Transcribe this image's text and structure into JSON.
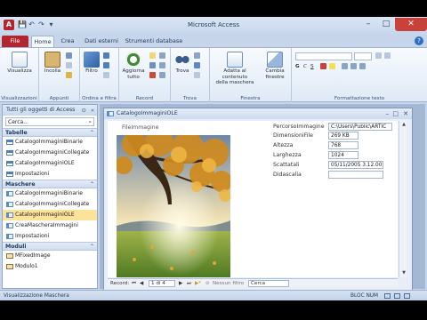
{
  "app": {
    "title": "Microsoft Access",
    "logo_letter": "A",
    "brand_color": "#b3262f"
  },
  "window_controls": {
    "minimize": "–",
    "maximize": "□",
    "close": "✕"
  },
  "quick_access": {
    "save": "💾",
    "undo": "↶",
    "redo": "↷",
    "customize": "▾"
  },
  "tabs": [
    {
      "label": "File"
    },
    {
      "label": "Home"
    },
    {
      "label": "Crea"
    },
    {
      "label": "Dati esterni"
    },
    {
      "label": "Strumenti database"
    }
  ],
  "ribbon": {
    "groups": {
      "views": {
        "label": "Visualizzazioni",
        "view_button": "Visualizza"
      },
      "clipboard": {
        "label": "Appunti",
        "paste_button": "Incolla"
      },
      "sort_filter": {
        "label": "Ordina e filtra",
        "filter_button": "Filtro"
      },
      "records": {
        "label": "Record",
        "refresh_button_line1": "Aggiorna",
        "refresh_button_line2": "tutto"
      },
      "find": {
        "label": "Trova",
        "find_button": "Trova"
      },
      "window": {
        "label": "Finestra",
        "fit_line1": "Adatta al contenuto",
        "fit_line2": "della maschera",
        "switch_line1": "Cambia",
        "switch_line2": "finestre"
      },
      "text_formatting": {
        "label": "Formattazione testo"
      }
    }
  },
  "nav_pane": {
    "title": "Tutti gli oggetti di Access",
    "search_value": "Cerca...",
    "sections": [
      {
        "title": "Tabelle",
        "items": [
          {
            "label": "CatalogoImmaginiBinarie",
            "icon": "table-icon"
          },
          {
            "label": "CatalogoImmaginiCollegate",
            "icon": "table-icon"
          },
          {
            "label": "CatalogoImmaginiOLE",
            "icon": "table-icon"
          },
          {
            "label": "Impostazioni",
            "icon": "table-icon"
          }
        ]
      },
      {
        "title": "Maschere",
        "items": [
          {
            "label": "CatalogoImmaginiBinarie",
            "icon": "form-icon"
          },
          {
            "label": "CatalogoImmaginiCollegate",
            "icon": "form-icon"
          },
          {
            "label": "CatalogoImmaginiOLE",
            "icon": "form-icon",
            "selected": true
          },
          {
            "label": "CreaMascheraImmagini",
            "icon": "form-icon"
          },
          {
            "label": "Impostazioni",
            "icon": "form-icon"
          }
        ]
      },
      {
        "title": "Moduli",
        "items": [
          {
            "label": "MFixedImage",
            "icon": "module-icon"
          },
          {
            "label": "Modulo1",
            "icon": "module-icon"
          }
        ]
      }
    ]
  },
  "form": {
    "title": "CatalogoImmaginiOLE",
    "image_label": "FileImmagine",
    "fields": [
      {
        "label": "PercorsoImmagine",
        "value": "C:\\Users\\Public\\ARTIC"
      },
      {
        "label": "DimensioniFile",
        "value": "269 KB"
      },
      {
        "label": "Altezza",
        "value": "768"
      },
      {
        "label": "Larghezza",
        "value": "1024"
      },
      {
        "label": "Scattatali",
        "value": "05/11/2005 3.12.00"
      },
      {
        "label": "Didascalia",
        "value": ""
      }
    ],
    "record_nav": {
      "label": "Record:",
      "position": "1 di 4",
      "filter": "Nessun filtro",
      "search": "Cerca"
    }
  },
  "status": {
    "left": "Visualizzazione Maschera",
    "right": "BLOC NUM"
  }
}
